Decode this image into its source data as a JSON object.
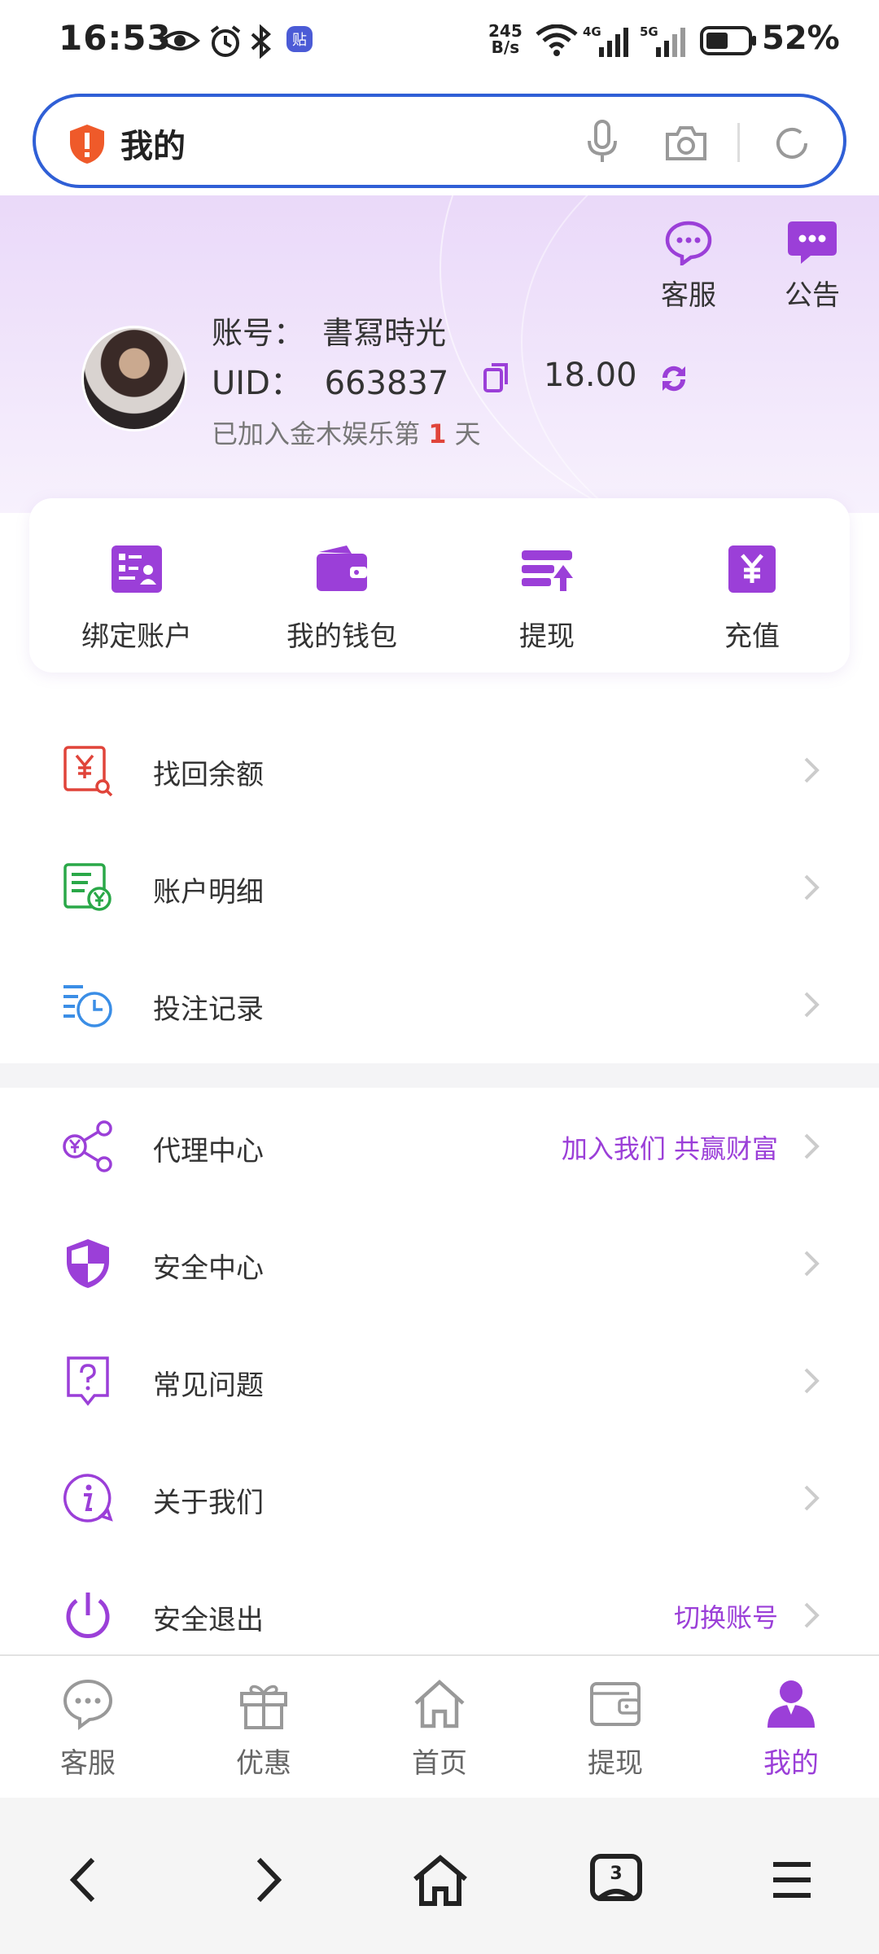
{
  "status": {
    "time": "16:53",
    "net_speed_top": "245",
    "net_speed_bottom": "B/s",
    "net1": "4G",
    "net2": "5G",
    "battery": "52%"
  },
  "browser": {
    "title": "我的"
  },
  "header": {
    "service_label": "客服",
    "notice_label": "公告",
    "account_prefix": "账号：",
    "account_name": "書冩時光",
    "uid_prefix": "UID：",
    "uid": "663837",
    "balance": "18.00",
    "joined_before": "已加入金木娱乐第",
    "joined_days": "1",
    "joined_after": "天"
  },
  "quick_actions": [
    {
      "label": "绑定账户",
      "icon": "bind-account-icon"
    },
    {
      "label": "我的钱包",
      "icon": "wallet-icon"
    },
    {
      "label": "提现",
      "icon": "withdraw-icon"
    },
    {
      "label": "充值",
      "icon": "recharge-icon"
    }
  ],
  "menu": {
    "recover_balance": "找回余额",
    "account_details": "账户明细",
    "bet_records": "投注记录",
    "agent_center": "代理中心",
    "agent_extra": "加入我们 共赢财富",
    "security_center": "安全中心",
    "faq": "常见问题",
    "about_us": "关于我们",
    "logout": "安全退出",
    "logout_extra": "切换账号"
  },
  "bottom_nav": [
    {
      "label": "客服",
      "icon": "chat-icon"
    },
    {
      "label": "优惠",
      "icon": "gift-icon"
    },
    {
      "label": "首页",
      "icon": "home-icon"
    },
    {
      "label": "提现",
      "icon": "wallet-icon"
    },
    {
      "label": "我的",
      "icon": "user-icon",
      "active": true
    }
  ],
  "browser_nav": {
    "tabs_count": "3"
  },
  "colors": {
    "accent": "#9b3fd8",
    "url_border": "#2f5fd6",
    "highlight": "#e0443a"
  }
}
